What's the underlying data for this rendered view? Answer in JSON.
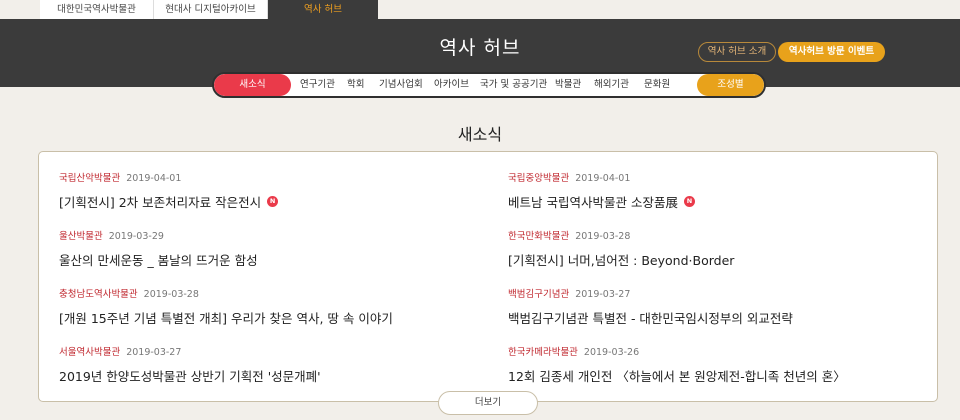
{
  "site_tabs": [
    "대한민국역사박물관",
    "현대사 디지털아카이브",
    "역사 허브"
  ],
  "header": {
    "title": "역사 허브",
    "intro_button": "역사 허브 소개",
    "event_button": "역사허브 방문 이벤트"
  },
  "nav": {
    "active": "새소식",
    "items": [
      "연구기관",
      "학회",
      "기념사업회",
      "아카이브",
      "국가 및 공공기관",
      "박물관",
      "해외기관",
      "문화원"
    ],
    "search": "조성별"
  },
  "section": {
    "title": "새소식",
    "more": "더보기"
  },
  "news": [
    {
      "org": "국립산악박물관",
      "date": "2019-04-01",
      "title": "[기획전시] 2차 보존처리자료 작은전시",
      "is_new": true,
      "new_label": "N"
    },
    {
      "org": "국립중앙박물관",
      "date": "2019-04-01",
      "title": "베트남 국립역사박물관 소장품展",
      "is_new": true,
      "new_label": "N"
    },
    {
      "org": "울산박물관",
      "date": "2019-03-29",
      "title": "울산의 만세운동 _ 봄날의 뜨거운 함성",
      "is_new": false
    },
    {
      "org": "한국만화박물관",
      "date": "2019-03-28",
      "title": "[기획전시] 너머,넘어전 : Beyond·Border",
      "is_new": false
    },
    {
      "org": "충청남도역사박물관",
      "date": "2019-03-28",
      "title": "[개원 15주년 기념 특별전 개최] 우리가 찾은 역사, 땅 속 이야기",
      "is_new": false
    },
    {
      "org": "백범김구기념관",
      "date": "2019-03-27",
      "title": "백범김구기념관 특별전 - 대한민국임시정부의 외교전략",
      "is_new": false
    },
    {
      "org": "서울역사박물관",
      "date": "2019-03-27",
      "title": "2019년 한양도성박물관 상반기 기획전 '성문개폐'",
      "is_new": false
    },
    {
      "org": "한국카메라박물관",
      "date": "2019-03-26",
      "title": "12회 김종세 개인전 〈하늘에서 본 원앙제전-합니족 천년의 혼〉",
      "is_new": false
    }
  ]
}
